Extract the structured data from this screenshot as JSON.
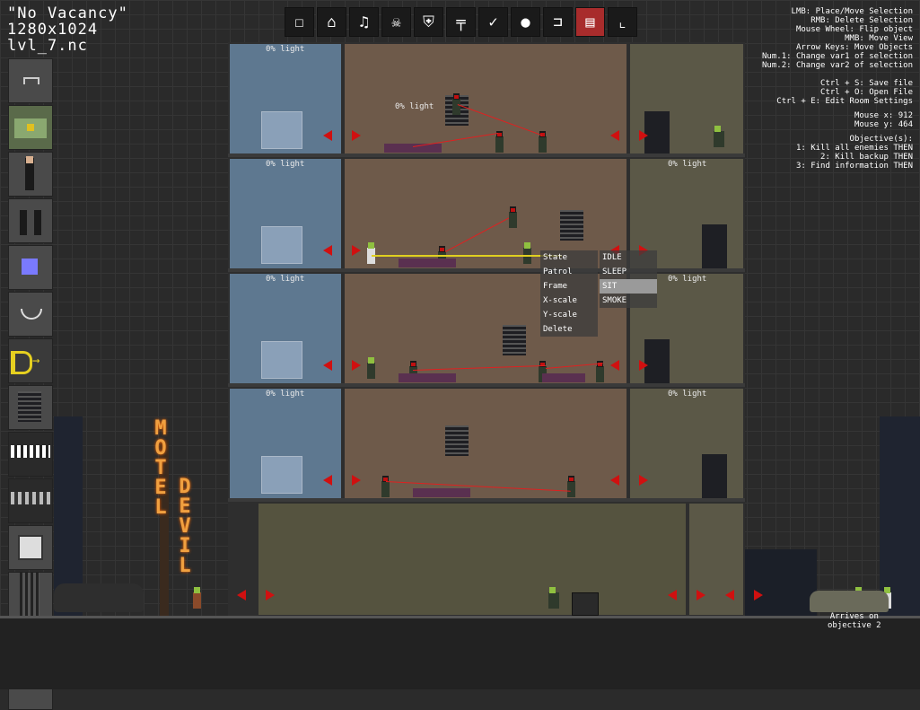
{
  "level": {
    "title": "\"No Vacancy\"",
    "resolution": "1280x1024",
    "filename": "lvl_7.nc"
  },
  "toolbar": [
    {
      "name": "square-tool",
      "glyph": "☐"
    },
    {
      "name": "house-tool",
      "glyph": "⌂"
    },
    {
      "name": "music-tool",
      "glyph": "♫"
    },
    {
      "name": "skull-tool",
      "glyph": "☠"
    },
    {
      "name": "shield-tool",
      "glyph": "⛨"
    },
    {
      "name": "gun-tool",
      "glyph": "╤"
    },
    {
      "name": "checkmark-tool",
      "glyph": "✓"
    },
    {
      "name": "lightbulb-tool",
      "glyph": "●"
    },
    {
      "name": "stairs-tool",
      "glyph": "⊐"
    },
    {
      "name": "fire-tool",
      "glyph": "▤"
    },
    {
      "name": "select-tool",
      "glyph": "⌞"
    }
  ],
  "help": {
    "controls": [
      "LMB: Place/Move Selection",
      "RMB: Delete Selection",
      "Mouse Wheel: Flip object",
      "MMB: Move View",
      "Arrow Keys: Move Objects",
      "Num.1: Change var1 of selection",
      "Num.2: Change var2 of selection"
    ],
    "file": [
      "Ctrl + S: Save file",
      "Ctrl + O: Open File",
      "Ctrl + E: Edit Room Settings"
    ],
    "mouse_x": "Mouse x: 912",
    "mouse_y": "Mouse y: 464",
    "objectives_title": "Objective(s):",
    "objectives": [
      "1: Kill all enemies THEN",
      "2: Kill backup THEN",
      "3: Find information THEN"
    ]
  },
  "lights": {
    "pct": "0% light"
  },
  "context_menu": {
    "labels": [
      "State",
      "Patrol",
      "Frame",
      "X-scale",
      "Y-scale",
      "Delete"
    ],
    "options": [
      "IDLE",
      "SLEEP",
      "SIT",
      "SMOKE"
    ],
    "selected": "SIT"
  },
  "sign": {
    "motel": [
      "M",
      "O",
      "T",
      "E",
      "L"
    ],
    "devil": [
      "D",
      "E",
      "V",
      "I",
      "L"
    ]
  },
  "arrives_note": "Arrives on\nobjective 2",
  "colors": {
    "active": "#a82c2c",
    "arrow": "#d01010",
    "neon": "#f0a040"
  }
}
